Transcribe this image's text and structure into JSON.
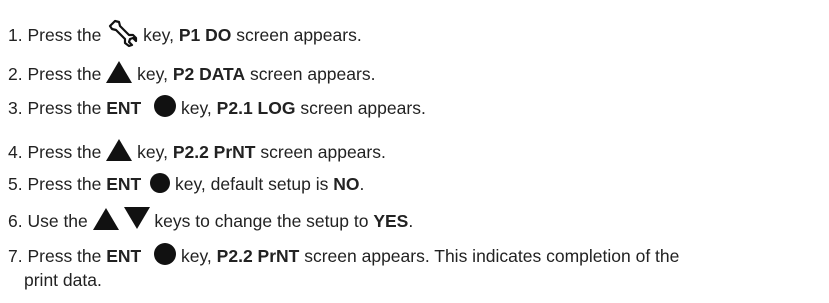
{
  "steps": [
    {
      "num": "1. Press the",
      "after": " key, ",
      "bold": "P1 DO",
      "tail": " screen appears."
    },
    {
      "num": "2. Press the",
      "after": " key, ",
      "bold": "P2 DATA",
      "tail": " screen appears."
    },
    {
      "num": "3. Press the ",
      "key": "ENT",
      "after": " key, ",
      "bold": "P2.1 LOG",
      "tail": " screen appears."
    },
    {
      "num": "4. Press the",
      "after": " key, ",
      "bold": "P2.2 PrNT",
      "tail": " screen appears."
    },
    {
      "num": "5. Press the ",
      "key": "ENT",
      "after": " key, default setup is ",
      "bold": "NO",
      "tail": "."
    },
    {
      "num": "6. Use the",
      "after": " keys to change the setup to ",
      "bold": "YES",
      "tail": "."
    },
    {
      "num": "7. Press the ",
      "key": "ENT",
      "after": " key, ",
      "bold": "P2.2 PrNT",
      "tail": " screen appears. This indicates completion of the",
      "cont": "print data."
    }
  ],
  "icons": {
    "step1": "wrench-icon",
    "step2": "up-arrow-icon",
    "step3": "enter-circle-icon",
    "step4": "up-arrow-icon",
    "step5": "enter-circle-icon",
    "step6_up": "up-arrow-icon",
    "step6_down": "down-arrow-icon",
    "step7": "enter-circle-icon"
  }
}
